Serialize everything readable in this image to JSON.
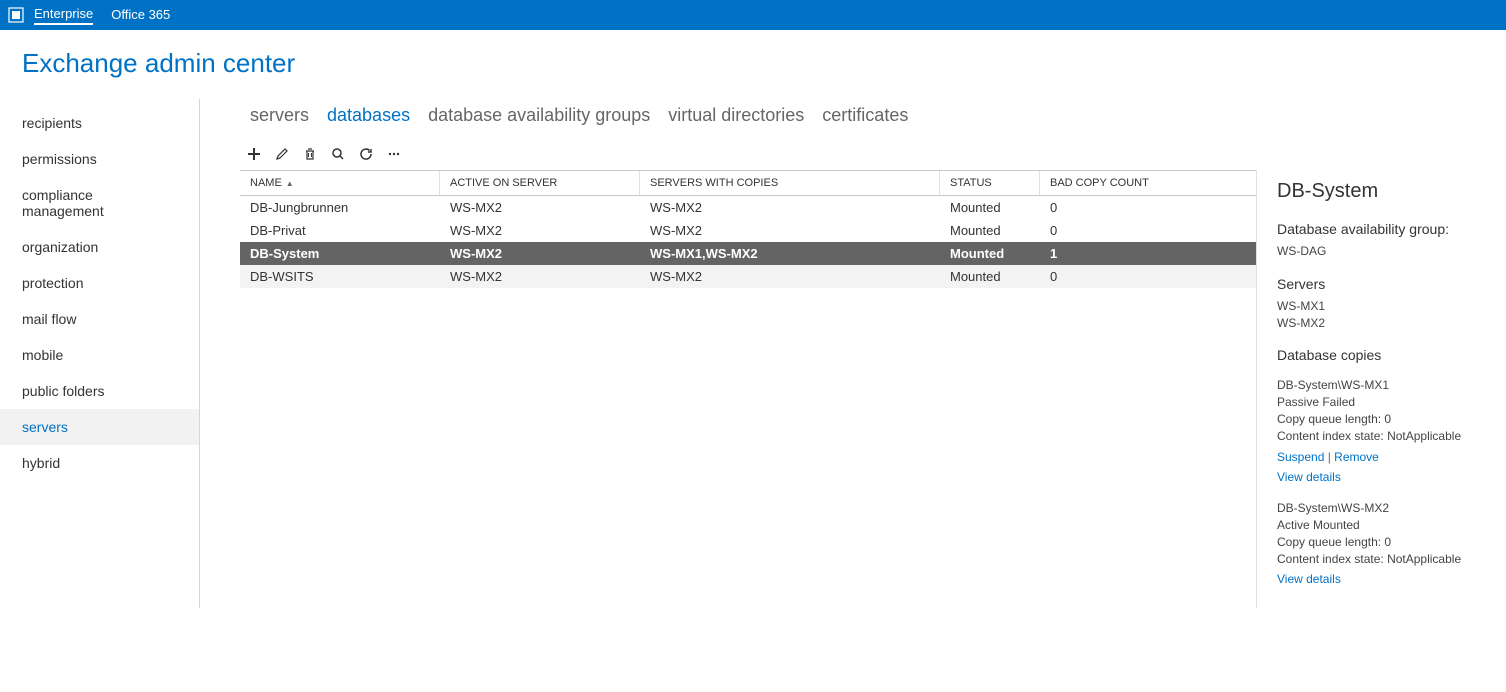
{
  "topbar": {
    "enterprise": "Enterprise",
    "office365": "Office 365"
  },
  "page_title": "Exchange admin center",
  "sidebar": {
    "items": [
      "recipients",
      "permissions",
      "compliance management",
      "organization",
      "protection",
      "mail flow",
      "mobile",
      "public folders",
      "servers",
      "hybrid"
    ],
    "active_index": 8
  },
  "tabs": {
    "items": [
      "servers",
      "databases",
      "database availability groups",
      "virtual directories",
      "certificates"
    ],
    "active_index": 1
  },
  "grid": {
    "headers": {
      "name": "NAME",
      "active": "ACTIVE ON SERVER",
      "copies": "SERVERS WITH COPIES",
      "status": "STATUS",
      "bad": "BAD COPY COUNT"
    },
    "rows": [
      {
        "name": "DB-Jungbrunnen",
        "active": "WS-MX2",
        "copies": "WS-MX2",
        "status": "Mounted",
        "bad": "0"
      },
      {
        "name": "DB-Privat",
        "active": "WS-MX2",
        "copies": "WS-MX2",
        "status": "Mounted",
        "bad": "0"
      },
      {
        "name": "DB-System",
        "active": "WS-MX2",
        "copies": "WS-MX1,WS-MX2",
        "status": "Mounted",
        "bad": "1"
      },
      {
        "name": "DB-WSITS",
        "active": "WS-MX2",
        "copies": "WS-MX2",
        "status": "Mounted",
        "bad": "0"
      }
    ],
    "selected_index": 2
  },
  "details": {
    "title": "DB-System",
    "dag_label": "Database availability group:",
    "dag_value": "WS-DAG",
    "servers_label": "Servers",
    "servers": [
      "WS-MX1",
      "WS-MX2"
    ],
    "copies_label": "Database copies",
    "copy1": {
      "name": "DB-System\\WS-MX1",
      "state": "Passive Failed",
      "queue": "Copy queue length: 0",
      "index": "Content index state: NotApplicable",
      "suspend": "Suspend",
      "remove": "Remove",
      "view": "View details"
    },
    "copy2": {
      "name": "DB-System\\WS-MX2",
      "state": "Active Mounted",
      "queue": "Copy queue length: 0",
      "index": "Content index state: NotApplicable",
      "view": "View details"
    }
  }
}
